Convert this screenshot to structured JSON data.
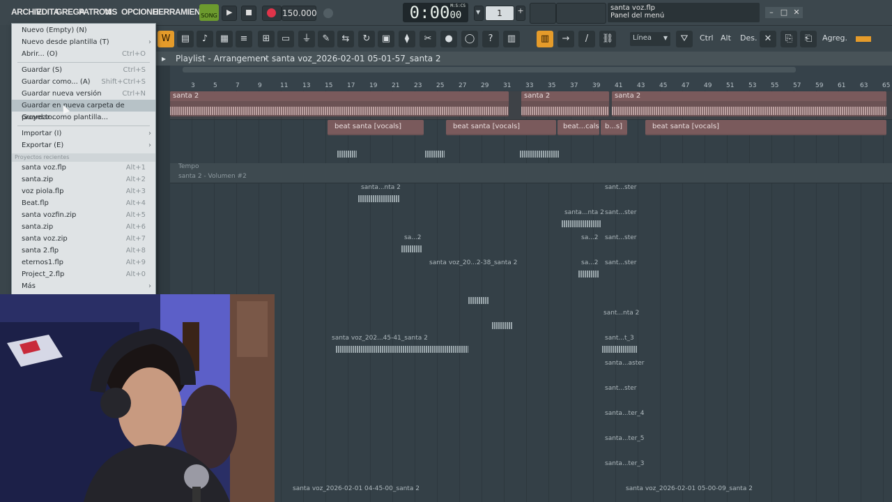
{
  "menubar": {
    "items": [
      "ARCHIV",
      "EDITA",
      "GREGA",
      "PATRON",
      "VIS",
      "OPCIONE",
      "HERRAMIENTA"
    ]
  },
  "transport": {
    "song_label": "SONG",
    "tempo": "150.000",
    "time": "0:00",
    "time_small": "00",
    "time_unit": "M:S:CS",
    "pattern_number": "1"
  },
  "hint": {
    "line1": "santa voz.flp",
    "line2": "Panel del menú"
  },
  "toolbar": {
    "snap_label": "Línea",
    "ctrl_label": "Ctrl",
    "alt_label": "Alt",
    "des_label": "Des.",
    "agreg_label": "Agreg."
  },
  "playlist": {
    "title": "Playlist - Arrangement",
    "separator": "›",
    "pattern_name": "santa voz_2026-02-01 05-01-57_santa 2",
    "ruler": [
      "3",
      "5",
      "7",
      "9",
      "11",
      "13",
      "15",
      "17",
      "19",
      "21",
      "23",
      "25",
      "27",
      "29",
      "31",
      "33",
      "35",
      "37",
      "39",
      "41",
      "43",
      "45",
      "47",
      "49",
      "51",
      "53",
      "55",
      "57",
      "59",
      "61",
      "63",
      "65"
    ]
  },
  "tracks": {
    "top_clips": [
      "santa 2",
      "santa 2",
      "santa 2"
    ],
    "beat_clips": [
      "beat santa [vocals]",
      "beat santa [vocals]",
      "beat...cals]",
      "b...s]",
      "beat santa [vocals]"
    ],
    "auto_label_1": "Tempo",
    "auto_label_2": "santa 2 - Volumen #2",
    "small_clips": [
      "santa...nta 2",
      "sant...ster",
      "santa...nta 2",
      "sant...ster",
      "sa...2",
      "sa...2",
      "sant...ster",
      "santa voz_20...2-38_santa 2",
      "sa...2",
      "sant...ster",
      "sant...nta 2",
      "santa voz_202...45-41_santa 2",
      "sant...t_3",
      "santa...aster",
      "sant...ster",
      "santa...ter_4",
      "santa...ter_5",
      "santa...ter_3",
      "santa...nta 2"
    ],
    "bottom_clips": [
      "santa voz_2026-02-01 04-45-00_santa 2",
      "santa voz_2026-02-01 05-00-09_santa 2"
    ]
  },
  "file_menu": {
    "items": [
      {
        "label": "Nuevo (Empty) (N)",
        "key": ""
      },
      {
        "label": "Nuevo desde plantilla (T)",
        "key": "",
        "arrow": "›"
      },
      {
        "label": "Abrir... (O)",
        "key": "Ctrl+O"
      },
      {
        "label": "Guardar (S)",
        "key": "Ctrl+S"
      },
      {
        "label": "Guardar como... (A)",
        "key": "Shift+Ctrl+S"
      },
      {
        "label": "Guardar nueva versión",
        "key": "Ctrl+N"
      },
      {
        "label": "Guardar en nueva carpeta de proyecto...",
        "key": ""
      },
      {
        "label": "Guardar como plantilla...",
        "key": ""
      },
      {
        "label": "Importar (I)",
        "key": "",
        "arrow": "›"
      },
      {
        "label": "Exportar (E)",
        "key": "",
        "arrow": "›"
      }
    ],
    "recent_header": "Proyectos recientes",
    "recent": [
      {
        "label": "santa voz.flp",
        "key": "Alt+1"
      },
      {
        "label": "santa.zip",
        "key": "Alt+2"
      },
      {
        "label": "voz piola.flp",
        "key": "Alt+3"
      },
      {
        "label": "Beat.flp",
        "key": "Alt+4"
      },
      {
        "label": "santa vozfin.zip",
        "key": "Alt+5"
      },
      {
        "label": "santa.zip",
        "key": "Alt+6"
      },
      {
        "label": "santa voz.zip",
        "key": "Alt+7"
      },
      {
        "label": "santa 2.flp",
        "key": "Alt+8"
      },
      {
        "label": "eternos1.flp",
        "key": "Alt+9"
      },
      {
        "label": "Project_2.flp",
        "key": "Alt+0"
      }
    ],
    "more": "Más",
    "more_arrow": "›"
  },
  "colors": {
    "accent_orange": "#e59b2a",
    "clip_red": "#6b5254",
    "song_green": "#6c9a2e"
  }
}
